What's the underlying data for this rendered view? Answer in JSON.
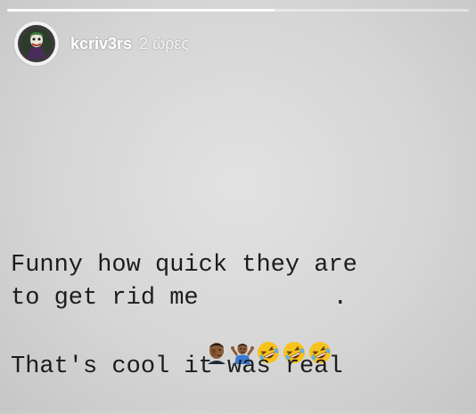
{
  "story": {
    "progress": 0.58,
    "user": {
      "username": "kcriv3rs",
      "timestamp": "2 ώρες",
      "avatar_icon": "joker-avatar-icon"
    },
    "caption": {
      "line1": "Funny how quick they are",
      "line2": "to get rid me",
      "line2_end": ".",
      "line3": "That's cool it was real"
    },
    "emojis": [
      "facepalm-emoji-icon",
      "shrug-emoji-icon",
      "rofl-emoji-icon",
      "rofl-emoji-icon",
      "rofl-emoji-icon"
    ],
    "colors": {
      "text": "#1c1c1c",
      "header_text": "#ffffff",
      "emoji_skin": "#8a5a36",
      "emoji_face": "#f7c21c"
    }
  }
}
